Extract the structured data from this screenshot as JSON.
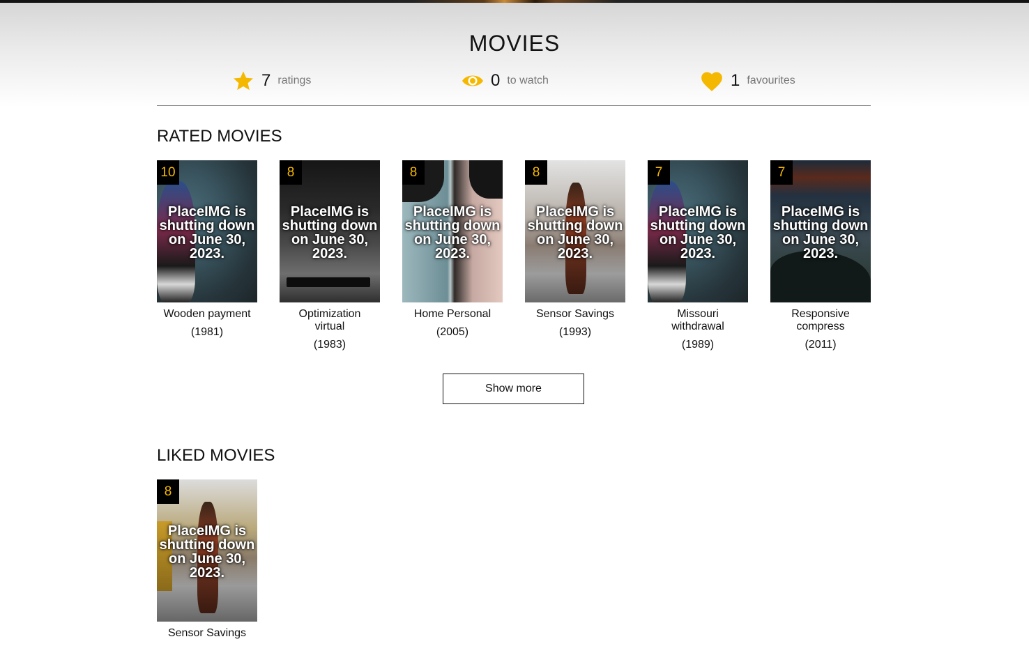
{
  "page": {
    "title": "MOVIES"
  },
  "stats": [
    {
      "icon": "star-icon",
      "count": "7",
      "label": "ratings"
    },
    {
      "icon": "eye-icon",
      "count": "0",
      "label": "to watch"
    },
    {
      "icon": "heart-icon",
      "count": "1",
      "label": "favourites"
    }
  ],
  "colors": {
    "accent": "#f5b800",
    "text": "#111111",
    "muted": "#777777"
  },
  "rated": {
    "heading": "RATED MOVIES",
    "movies": [
      {
        "rating": "10",
        "title": "Wooden payment",
        "year": "(1981)",
        "poster_text": "PlaceIMG is shutting down on June 30, 2023."
      },
      {
        "rating": "8",
        "title": "Optimization virtual",
        "year": "(1983)",
        "poster_text": "PlaceIMG is shutting down on June 30, 2023."
      },
      {
        "rating": "8",
        "title": "Home Personal",
        "year": "(2005)",
        "poster_text": "PlaceIMG is shutting down on June 30, 2023."
      },
      {
        "rating": "8",
        "title": "Sensor Savings",
        "year": "(1993)",
        "poster_text": "PlaceIMG is shutting down on June 30, 2023."
      },
      {
        "rating": "7",
        "title": "Missouri withdrawal",
        "year": "(1989)",
        "poster_text": "PlaceIMG is shutting down on June 30, 2023."
      },
      {
        "rating": "7",
        "title": "Responsive compress",
        "year": "(2011)",
        "poster_text": "PlaceIMG is shutting down on June 30, 2023."
      }
    ],
    "show_more_label": "Show more"
  },
  "liked": {
    "heading": "LIKED MOVIES",
    "movies": [
      {
        "rating": "8",
        "title": "Sensor Savings",
        "poster_text": "PlaceIMG is shutting down on June 30, 2023."
      }
    ]
  }
}
